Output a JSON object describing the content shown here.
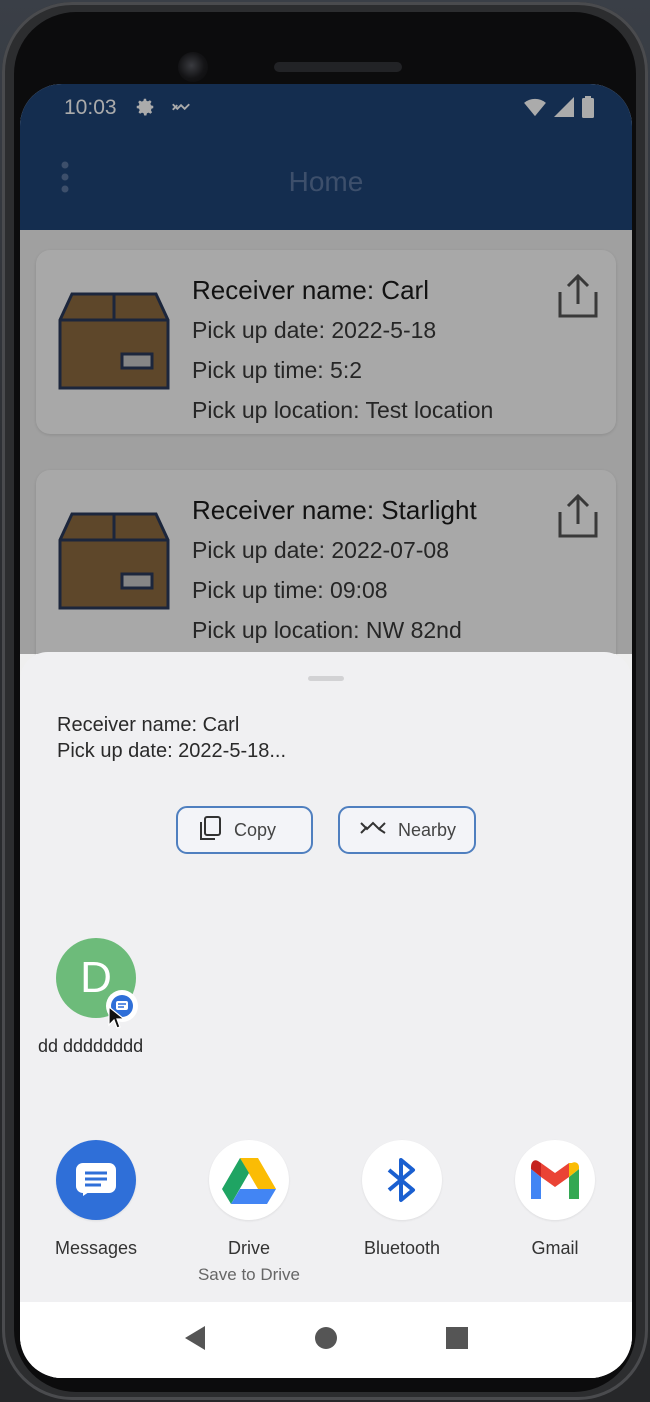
{
  "status_bar": {
    "time": "10:03"
  },
  "app_bar": {
    "title": "Home"
  },
  "cards": [
    {
      "name": "Receiver name: Carl",
      "date": "Pick up date: 2022-5-18",
      "time": "Pick up time: 5:2",
      "location": "Pick up location: Test location"
    },
    {
      "name": "Receiver name: Starlight",
      "date": "Pick up date: 2022-07-08",
      "time": "Pick up time: 09:08",
      "location": "Pick up location: NW 82nd"
    }
  ],
  "share_sheet": {
    "preview_line1": "Receiver name: Carl",
    "preview_line2": "Pick up date: 2022-5-18...",
    "copy_label": "Copy",
    "nearby_label": "Nearby",
    "contact": {
      "initial": "D",
      "name": "dd dddddddd"
    },
    "apps": [
      {
        "label": "Messages"
      },
      {
        "label": "Drive",
        "sublabel": "Save to Drive"
      },
      {
        "label": "Bluetooth"
      },
      {
        "label": "Gmail"
      }
    ]
  },
  "colors": {
    "app_bar": "#1f4477",
    "accent": "#4f7fbf",
    "contact_avatar": "#6dbb7a",
    "messages": "#2f6fd8"
  }
}
